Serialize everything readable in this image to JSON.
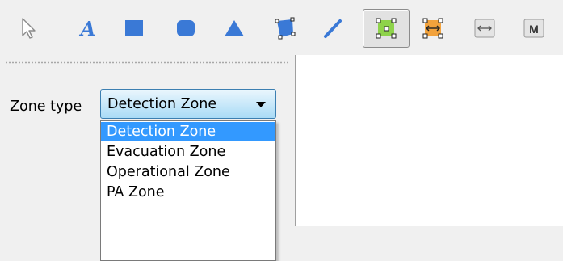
{
  "toolbar": {
    "tools": [
      {
        "name": "pointer-icon",
        "active": false
      },
      {
        "name": "text-tool-icon",
        "active": false
      },
      {
        "name": "rectangle-tool-icon",
        "active": false
      },
      {
        "name": "rounded-rectangle-tool-icon",
        "active": false
      },
      {
        "name": "triangle-tool-icon",
        "active": false
      },
      {
        "name": "polygon-tool-icon",
        "active": false
      },
      {
        "name": "line-tool-icon",
        "active": false
      },
      {
        "name": "zone-polygon-tool-icon",
        "active": true
      },
      {
        "name": "zone-orange-tool-icon",
        "active": false
      },
      {
        "name": "measure-tool-icon",
        "active": false
      },
      {
        "name": "marker-tool-icon",
        "active": false
      }
    ],
    "marker_letter": "M"
  },
  "form": {
    "zone_type_label": "Zone type",
    "zone_type_value": "Detection Zone",
    "options": [
      "Detection Zone",
      "Evacuation Zone",
      "Operational Zone",
      "PA Zone"
    ],
    "selected_index": 0
  },
  "colors": {
    "icon_blue": "#3a79d6",
    "selection": "#3399ff",
    "active_zone_green": "#8ed34a",
    "zone_orange": "#f2a23c"
  }
}
